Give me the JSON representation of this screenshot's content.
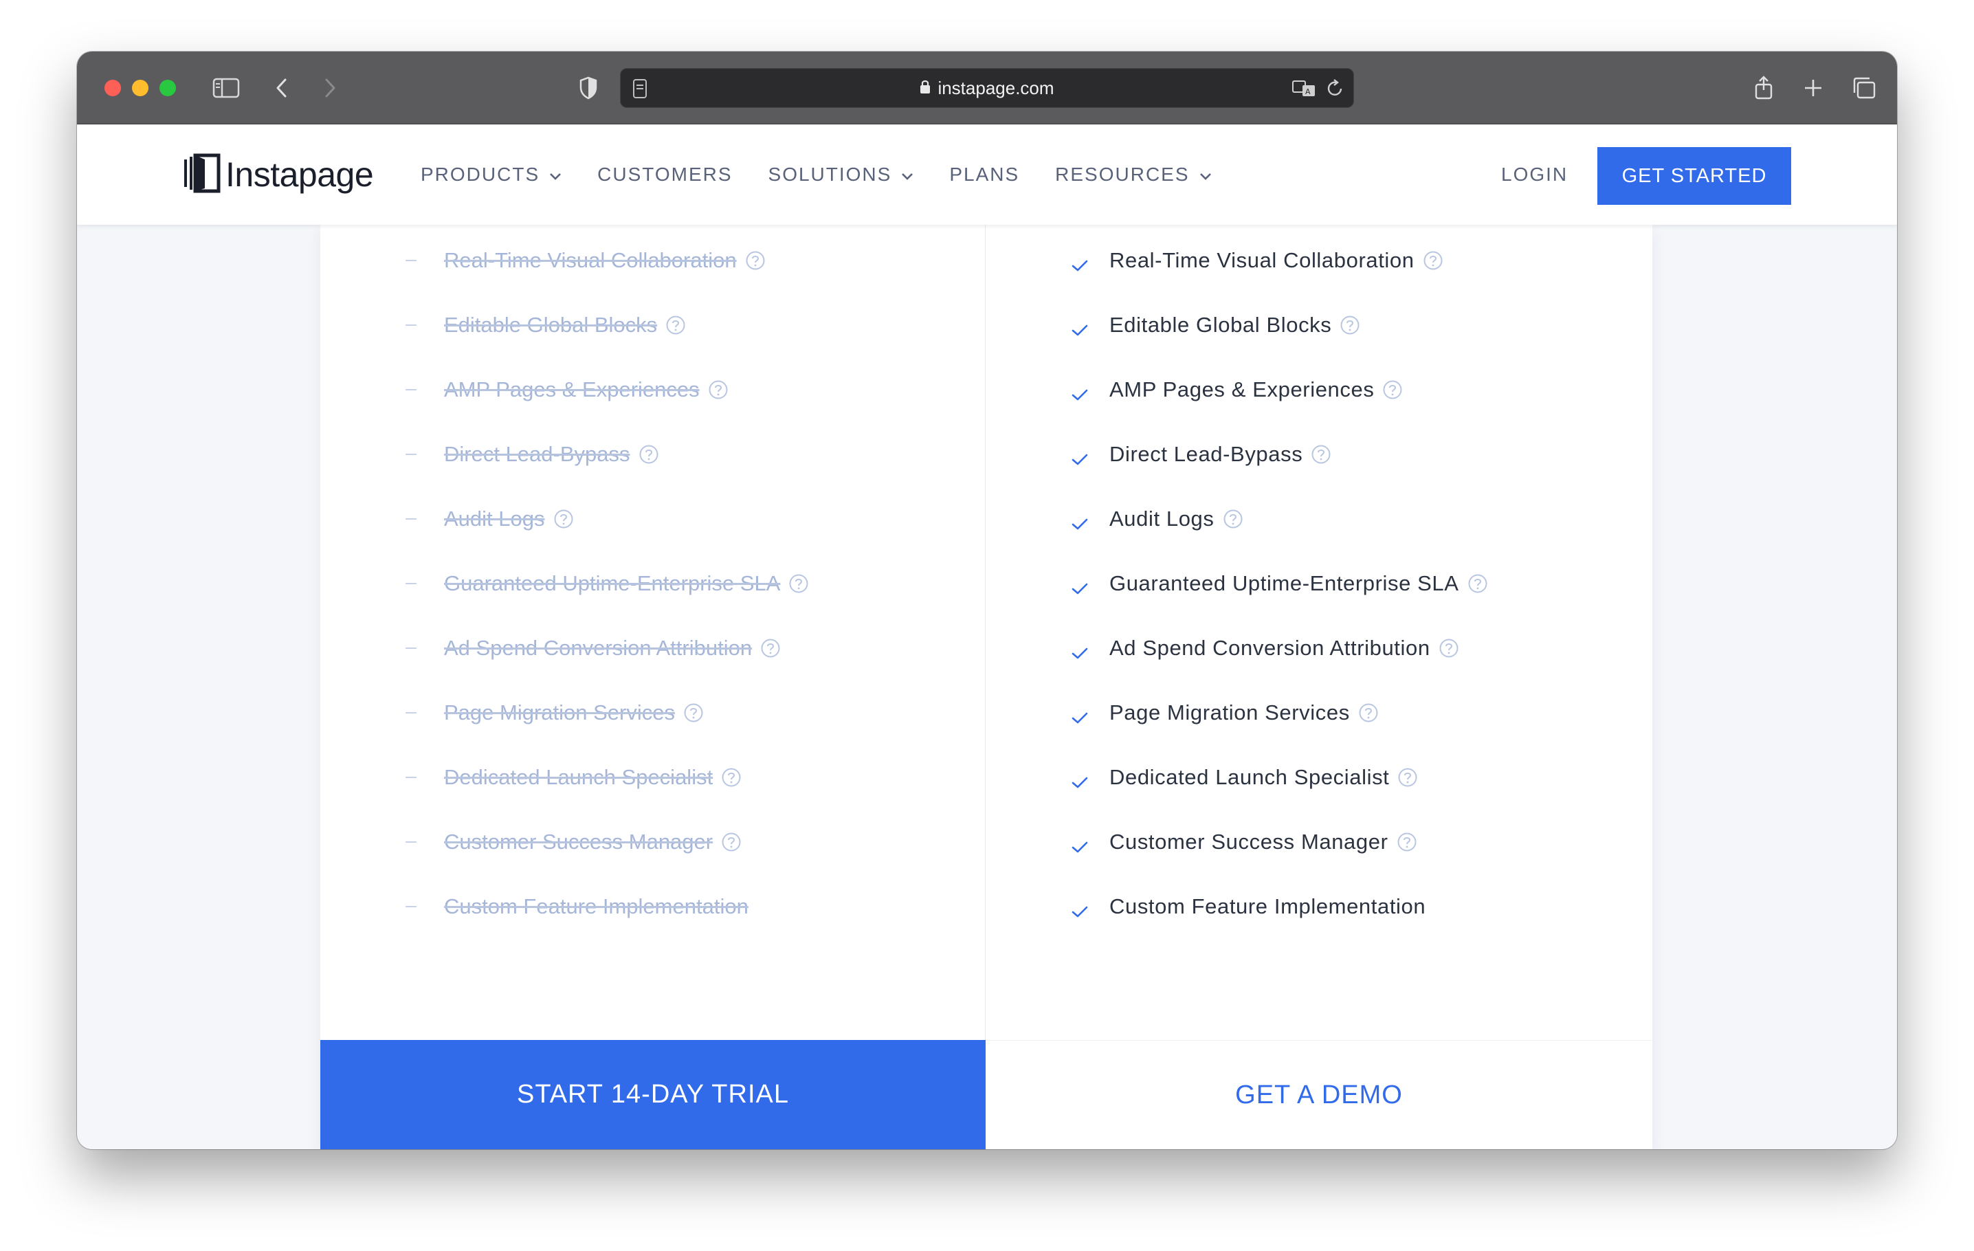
{
  "browser": {
    "url": "instapage.com"
  },
  "header": {
    "logo_text": "Instapage",
    "nav": [
      {
        "label": "PRODUCTS",
        "has_dropdown": true
      },
      {
        "label": "CUSTOMERS",
        "has_dropdown": false
      },
      {
        "label": "SOLUTIONS",
        "has_dropdown": true
      },
      {
        "label": "PLANS",
        "has_dropdown": false
      },
      {
        "label": "RESOURCES",
        "has_dropdown": true
      }
    ],
    "login_label": "LOGIN",
    "cta_label": "GET STARTED"
  },
  "plans": {
    "left": {
      "features": [
        "Real-Time Visual Collaboration",
        "Editable Global Blocks",
        "AMP Pages & Experiences",
        "Direct Lead-Bypass",
        "Audit Logs",
        "Guaranteed Uptime-Enterprise SLA",
        "Ad Spend Conversion Attribution",
        "Page Migration Services",
        "Dedicated Launch Specialist",
        "Customer Success Manager",
        "Custom Feature Implementation"
      ],
      "button_label": "START 14-DAY TRIAL"
    },
    "right": {
      "features": [
        "Real-Time Visual Collaboration",
        "Editable Global Blocks",
        "AMP Pages & Experiences",
        "Direct Lead-Bypass",
        "Audit Logs",
        "Guaranteed Uptime-Enterprise SLA",
        "Ad Spend Conversion Attribution",
        "Page Migration Services",
        "Dedicated Launch Specialist",
        "Customer Success Manager",
        "Custom Feature Implementation"
      ],
      "button_label": "GET A DEMO"
    }
  },
  "colors": {
    "brand_blue": "#326bea",
    "disabled_text": "#a6b6d8",
    "enabled_text": "#2b3240"
  }
}
